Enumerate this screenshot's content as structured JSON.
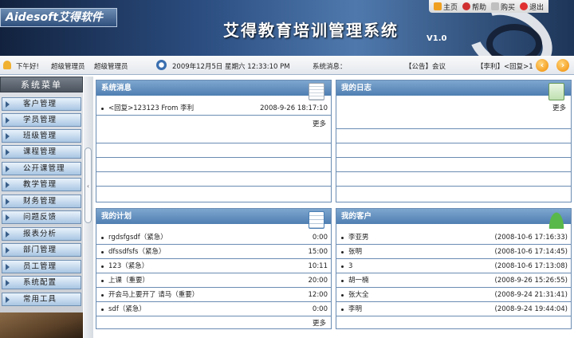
{
  "header": {
    "logo": "Aidesoft艾得软件",
    "title": "艾得教育培训管理系统",
    "version": "V1.0",
    "nav": [
      {
        "label": "主页",
        "icon": "home-icon",
        "color": "#f0a020"
      },
      {
        "label": "帮助",
        "icon": "help-icon",
        "color": "#d03030"
      },
      {
        "label": "购买",
        "icon": "cart-icon",
        "color": "#c0c0c0"
      },
      {
        "label": "退出",
        "icon": "exit-icon",
        "color": "#e03030"
      }
    ]
  },
  "infobar": {
    "greeting": "下午好!",
    "role": "超级管理员",
    "user": "超级管理员",
    "datetime": "2009年12月5日 星期六 12:33:10 PM",
    "message_label": "系统消息：",
    "notice": "【公告】会议",
    "reply": "【李利】<回复>1"
  },
  "sidebar": {
    "title": "系统菜单",
    "items": [
      "客户管理",
      "学员管理",
      "班级管理",
      "课程管理",
      "公开课管理",
      "教学管理",
      "财务管理",
      "问题反馈",
      "报表分析",
      "部门管理",
      "员工管理",
      "系统配置",
      "常用工具"
    ]
  },
  "panels": {
    "messages": {
      "title": "系统消息",
      "rows": [
        {
          "text": "<回复>123123    From 李利",
          "right": "2008-9-26 18:17:10"
        }
      ],
      "more": "更多"
    },
    "diary": {
      "title": "我的日志",
      "more": "更多"
    },
    "plans": {
      "title": "我的计划",
      "rows": [
        {
          "text": "rgdsfgsdf（紧急）",
          "right": "0:00"
        },
        {
          "text": "dfssdfsfs（紧急）",
          "right": "15:00"
        },
        {
          "text": "123（紧急）",
          "right": "10:11"
        },
        {
          "text": "上课（重要）",
          "right": "20:00"
        },
        {
          "text": "开会马上要开了 请马（重要）",
          "right": "12:00"
        },
        {
          "text": "sdf（紧急）",
          "right": "0:00"
        }
      ],
      "more": "更多"
    },
    "customers": {
      "title": "我的客户",
      "rows": [
        {
          "text": "李亚男",
          "right": "(2008-10-6 17:16:33)"
        },
        {
          "text": "张明",
          "right": "(2008-10-6 17:14:45)"
        },
        {
          "text": "3",
          "right": "(2008-10-6 17:13:08)"
        },
        {
          "text": "胡一楠",
          "right": "(2008-9-26 15:26:55)"
        },
        {
          "text": "张大全",
          "right": "(2008-9-24 21:31:41)"
        },
        {
          "text": "李明",
          "right": "(2008-9-24 19:44:04)"
        }
      ]
    }
  }
}
